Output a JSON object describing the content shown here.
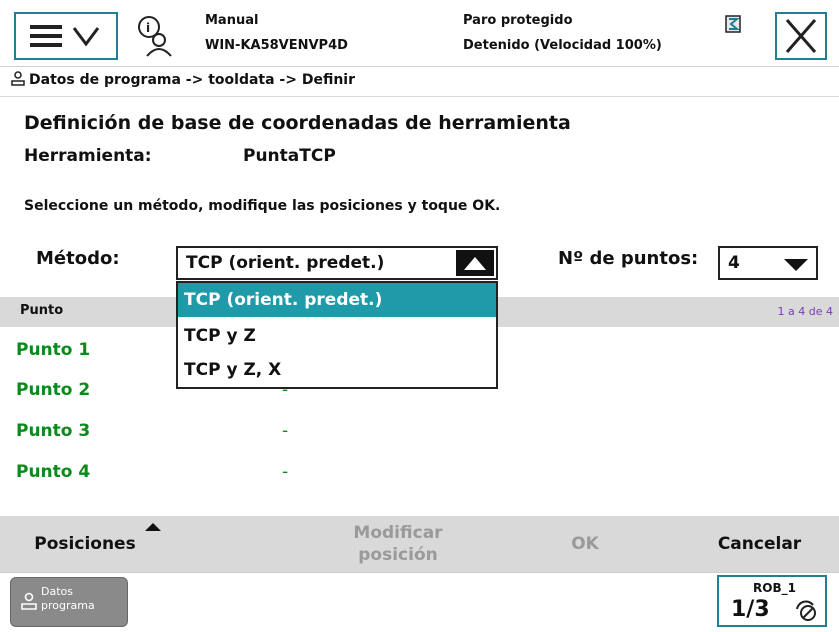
{
  "topbar": {
    "mode": "Manual",
    "controller": "WIN-KA58VENVP4D",
    "safety_state": "Paro protegido",
    "run_state": "Detenido (Velocidad 100%)"
  },
  "breadcrumb": "Datos de programa -> tooldata -> Definir",
  "page": {
    "title": "Definición de base de coordenadas de herramienta",
    "tool_label": "Herramienta:",
    "tool_value": "PuntaTCP",
    "instruction": "Seleccione un método, modifique las posiciones y toque OK.",
    "method_label": "Método:",
    "method_selected": "TCP (orient. predet.)",
    "points_label": "Nº de puntos:",
    "points_selected": "4"
  },
  "dropdown": {
    "options": [
      "TCP (orient. predet.)",
      "TCP y Z",
      "TCP y Z, X"
    ]
  },
  "table": {
    "column": "Punto",
    "range": "1 a 4 de 4",
    "rows": [
      {
        "label": "Punto 1",
        "value": "-"
      },
      {
        "label": "Punto 2",
        "value": "-"
      },
      {
        "label": "Punto 3",
        "value": "-"
      },
      {
        "label": "Punto 4",
        "value": "-"
      }
    ]
  },
  "actions": {
    "positions": "Posiciones",
    "modify_line1": "Modificar",
    "modify_line2": "posición",
    "ok": "OK",
    "cancel": "Cancelar"
  },
  "taskbar": {
    "app_line1": "Datos",
    "app_line2": "programa",
    "robot": "ROB_1",
    "speed": "1/3"
  },
  "colors": {
    "accent": "#1f7f95",
    "selection": "#1e9aa8",
    "row_text": "#0a8a1a"
  }
}
